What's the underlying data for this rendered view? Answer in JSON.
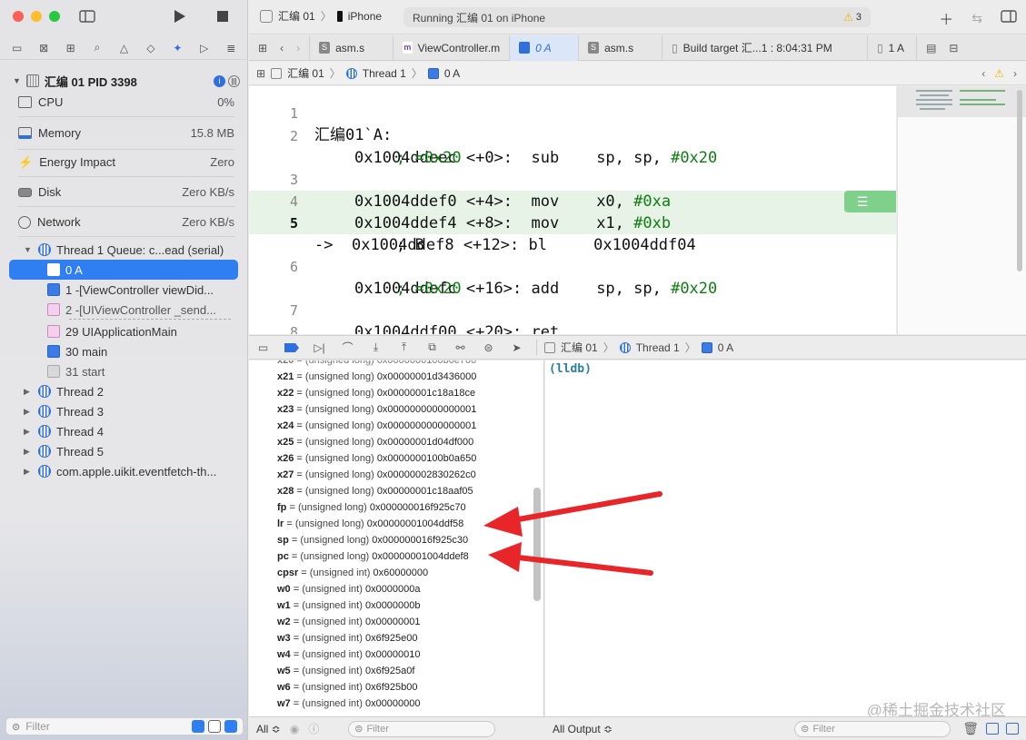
{
  "toolbar": {
    "scheme_name": "汇编 01",
    "device": "iPhone",
    "status": "Running 汇编 01 on iPhone",
    "warnings_count": "3"
  },
  "tabs": [
    {
      "label": "asm.s",
      "icon": "S"
    },
    {
      "label": "ViewController.m",
      "icon": "m"
    },
    {
      "label": "0 A",
      "icon": "frame-icon"
    },
    {
      "label": "asm.s",
      "icon": "S"
    },
    {
      "label": "Build target 汇...1 : 8:04:31 PM",
      "icon": "doc-icon"
    },
    {
      "label": "1 A",
      "icon": "doc-icon"
    }
  ],
  "jumpbar": {
    "items": [
      "汇编 01",
      "Thread 1",
      "0 A"
    ]
  },
  "sidebar": {
    "process": "汇编 01 PID 3398",
    "gauges": [
      {
        "label": "CPU",
        "value": "0%"
      },
      {
        "label": "Memory",
        "value": "15.8 MB"
      },
      {
        "label": "Energy Impact",
        "value": "Zero"
      },
      {
        "label": "Disk",
        "value": "Zero KB/s"
      },
      {
        "label": "Network",
        "value": "Zero KB/s"
      }
    ],
    "thread1": "Thread 1 Queue: c...ead (serial)",
    "frames": [
      {
        "label": "0 A",
        "selected": true
      },
      {
        "label": "1 -[ViewController viewDid..."
      },
      {
        "label": "2 -[UIViewController _send..."
      },
      {
        "label": "29 UIApplicationMain"
      },
      {
        "label": "30 main"
      },
      {
        "label": "31 start"
      }
    ],
    "threads": [
      "Thread 2",
      "Thread 3",
      "Thread 4",
      "Thread 5",
      "com.apple.uikit.eventfetch-th..."
    ],
    "filter_placeholder": "Filter"
  },
  "editor": {
    "lines": [
      {
        "n": "1",
        "text": "汇编01`A:"
      },
      {
        "n": "2",
        "addr": "0x1004ddeec",
        "off": "<+0>:",
        "op": "sub",
        "args": "sp, sp, ",
        "imm": "#0x20",
        "cmt": "; =0x20"
      },
      {
        "n": "3",
        "addr": "0x1004ddef0",
        "off": "<+4>:",
        "op": "mov",
        "args": "x0, ",
        "imm": "#0xa"
      },
      {
        "n": "4",
        "addr": "0x1004ddef4",
        "off": "<+8>:",
        "op": "mov",
        "args": "x1, ",
        "imm": "#0xb"
      },
      {
        "n": "5",
        "marker": "->",
        "addr": "0x1004ddef8",
        "off": "<+12>:",
        "op": "bl",
        "args": "0x1004ddf04",
        "cmt": "; B"
      },
      {
        "n": "6",
        "addr": "0x1004ddefc",
        "off": "<+16>:",
        "op": "add",
        "args": "sp, sp, ",
        "imm": "#0x20",
        "cmt": "; =0x20"
      },
      {
        "n": "7",
        "addr": "0x1004ddf00",
        "off": "<+20>:",
        "op": "ret"
      },
      {
        "n": "8"
      }
    ]
  },
  "debugbar": {
    "crumbs": [
      "汇编 01",
      "Thread 1",
      "0 A"
    ]
  },
  "variables": [
    {
      "name": "x21",
      "type": "(unsigned long)",
      "value": "0x00000001d3436000"
    },
    {
      "name": "x22",
      "type": "(unsigned long)",
      "value": "0x00000001c18a18ce"
    },
    {
      "name": "x23",
      "type": "(unsigned long)",
      "value": "0x0000000000000001"
    },
    {
      "name": "x24",
      "type": "(unsigned long)",
      "value": "0x0000000000000001"
    },
    {
      "name": "x25",
      "type": "(unsigned long)",
      "value": "0x00000001d04df000"
    },
    {
      "name": "x26",
      "type": "(unsigned long)",
      "value": "0x0000000100b0a650"
    },
    {
      "name": "x27",
      "type": "(unsigned long)",
      "value": "0x00000002830262c0"
    },
    {
      "name": "x28",
      "type": "(unsigned long)",
      "value": "0x00000001c18aaf05"
    },
    {
      "name": "fp",
      "type": "(unsigned long)",
      "value": "0x000000016f925c70"
    },
    {
      "name": "lr",
      "type": "(unsigned long)",
      "value": "0x00000001004ddf58"
    },
    {
      "name": "sp",
      "type": "(unsigned long)",
      "value": "0x000000016f925c30"
    },
    {
      "name": "pc",
      "type": "(unsigned long)",
      "value": "0x00000001004ddef8"
    },
    {
      "name": "cpsr",
      "type": "(unsigned int)",
      "value": "0x60000000"
    },
    {
      "name": "w0",
      "type": "(unsigned int)",
      "value": "0x0000000a"
    },
    {
      "name": "w1",
      "type": "(unsigned int)",
      "value": "0x0000000b"
    },
    {
      "name": "w2",
      "type": "(unsigned int)",
      "value": "0x00000001"
    },
    {
      "name": "w3",
      "type": "(unsigned int)",
      "value": "0x6f925e00"
    },
    {
      "name": "w4",
      "type": "(unsigned int)",
      "value": "0x00000010"
    },
    {
      "name": "w5",
      "type": "(unsigned int)",
      "value": "0x6f925a0f"
    },
    {
      "name": "w6",
      "type": "(unsigned int)",
      "value": "0x6f925b00"
    },
    {
      "name": "w7",
      "type": "(unsigned int)",
      "value": "0x00000000"
    }
  ],
  "console": {
    "prompt": "(lldb)",
    "watermark": "@稀土掘金技术社区"
  },
  "footer": {
    "scope": "All ≎",
    "filter_placeholder": "Filter",
    "output": "All Output ≎"
  },
  "colors": {
    "accent": "#2f7ff2",
    "pc_highlight": "#e7f3e6",
    "immediate_green": "#0f7d12",
    "annotation_arrow": "#e8262a"
  }
}
